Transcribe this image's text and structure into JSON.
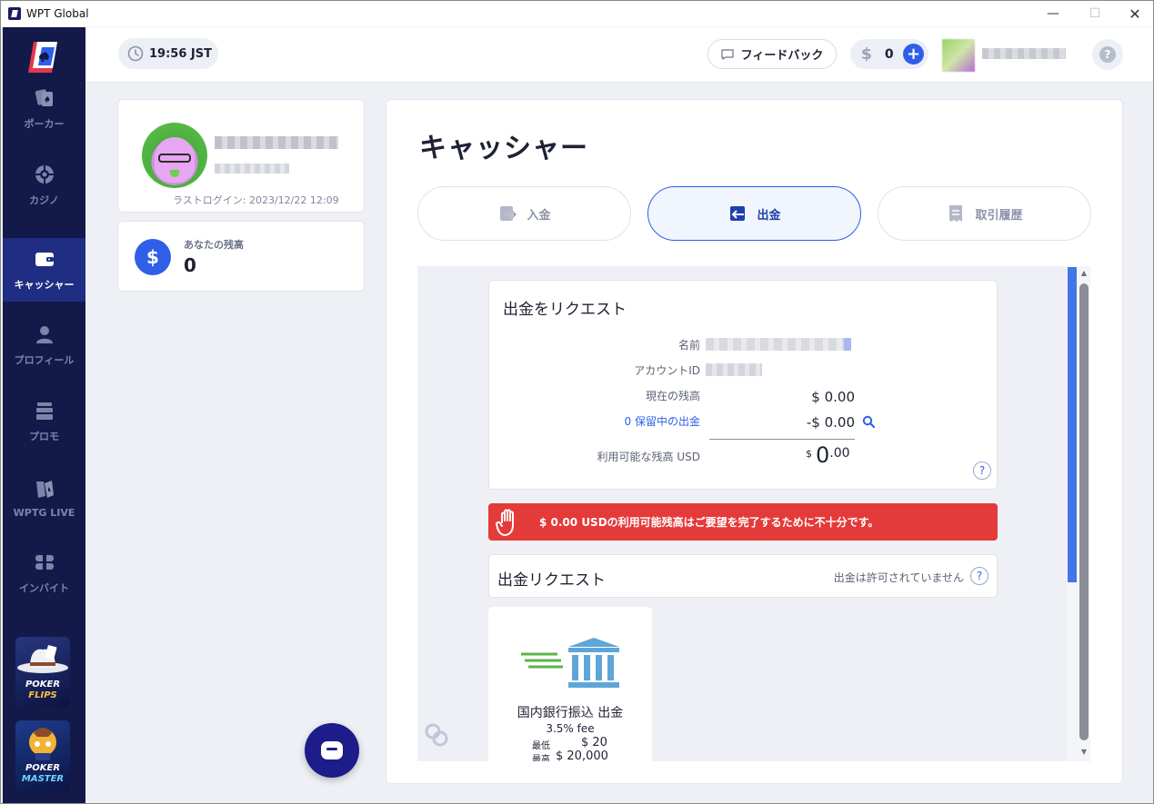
{
  "window": {
    "title": "WPT Global",
    "controls": {
      "minimize": "—",
      "maximize": "☐",
      "close": "✕"
    }
  },
  "sidebar": {
    "items": [
      {
        "label": "ポーカー",
        "icon": "cards-icon"
      },
      {
        "label": "カジノ",
        "icon": "roulette-icon"
      },
      {
        "label": "キャッシャー",
        "icon": "wallet-icon"
      },
      {
        "label": "プロフィール",
        "icon": "person-icon"
      },
      {
        "label": "プロモ",
        "icon": "promo-icon"
      },
      {
        "label": "WPTG LIVE",
        "icon": "live-icon"
      },
      {
        "label": "インバイト",
        "icon": "invite-icon"
      }
    ],
    "active_index": 2,
    "promos": [
      {
        "line1": "POKER",
        "line2": "FLIPS"
      },
      {
        "line1": "POKER",
        "line2": "MASTER"
      }
    ]
  },
  "topbar": {
    "time": "19:56 JST",
    "feedback_label": "フィードバック",
    "currency_symbol": "$",
    "balance": "0",
    "add_symbol": "+",
    "help_symbol": "?"
  },
  "profile": {
    "last_login": "ラストログイン: 2023/12/22 12:09",
    "balance_label": "あなたの残高",
    "balance_value": "0",
    "balance_symbol": "$"
  },
  "cashier": {
    "title": "キャッシャー",
    "tabs": [
      {
        "label": "入金"
      },
      {
        "label": "出金"
      },
      {
        "label": "取引履歴"
      }
    ],
    "active_tab": 1,
    "request": {
      "title": "出金をリクエスト",
      "name_label": "名前",
      "account_label": "アカウントID",
      "current_balance_label": "現在の残高",
      "current_balance_value": "$ 0.00",
      "pending_label": "0 保留中の出金",
      "pending_value": "-$ 0.00",
      "available_label": "利用可能な残高 USD",
      "available_symbol": "$",
      "available_int": "0",
      "available_dec": ".00",
      "help_symbol": "?"
    },
    "alert": "$ 0.00 USDの利用可能残高はご要望を完了するために不十分です。",
    "withdraw_requests": {
      "title": "出金リクエスト",
      "note": "出金は許可されていません",
      "help_symbol": "?"
    },
    "methods": [
      {
        "title": "国内銀行振込 出金",
        "fee": "3.5% fee",
        "min_label": "最低",
        "min_value": "$ 20",
        "max_label": "最高",
        "max_value": "$ 20,000"
      }
    ]
  },
  "colors": {
    "nav_bg": "#131a4a",
    "nav_active": "#1f2d82",
    "accent": "#2f5fe8",
    "alert": "#e53a3a",
    "chat": "#1d1c8a"
  }
}
